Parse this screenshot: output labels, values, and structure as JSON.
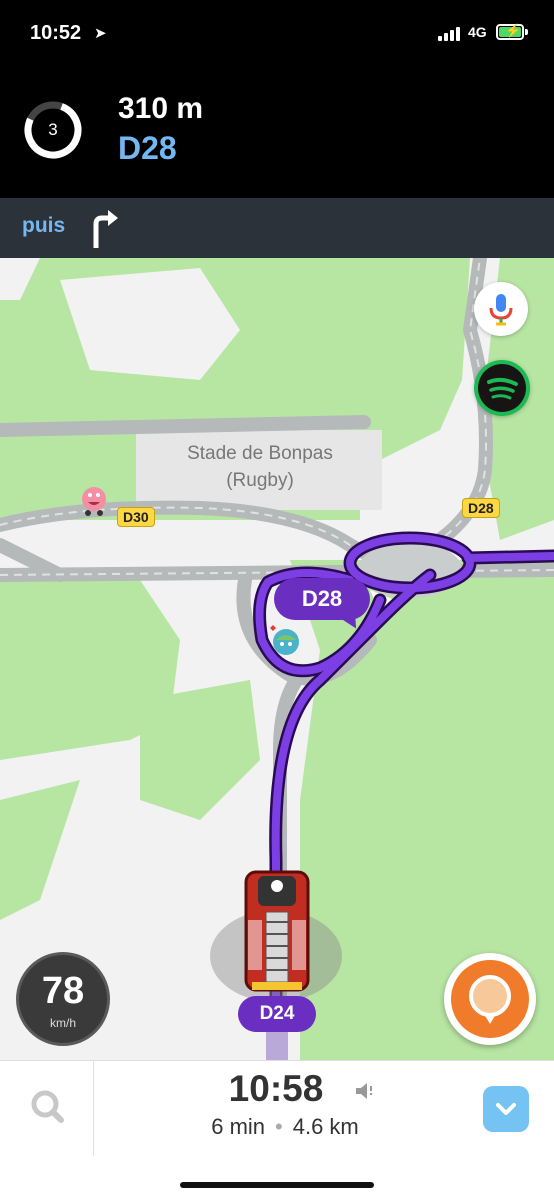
{
  "status_bar": {
    "time": "10:52",
    "network": "4G"
  },
  "navigation": {
    "countdown": "3",
    "distance": "310 m",
    "road": "D28",
    "then_label": "puis",
    "then_icon": "turn-right-icon"
  },
  "map": {
    "poi_name_line1": "Stade de Bonpas",
    "poi_name_line2": "(Rugby)",
    "road_labels": [
      "D30",
      "D28"
    ],
    "route_bubble": "D28",
    "current_road": "D24"
  },
  "controls": {
    "mic_icon": "microphone-icon",
    "spotify_icon": "spotify-icon",
    "report_icon": "report-icon"
  },
  "speedometer": {
    "speed": "78",
    "unit": "km/h"
  },
  "eta_panel": {
    "arrival_time": "10:58",
    "duration": "6 min",
    "separator": "•",
    "distance": "4.6 km"
  },
  "colors": {
    "route": "#6a2fc0",
    "accent_blue": "#74b8f2",
    "park_green": "#b7e5a2",
    "report_orange": "#f07b2a"
  }
}
